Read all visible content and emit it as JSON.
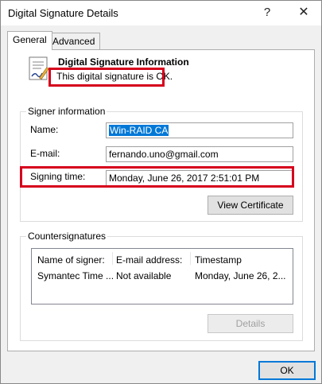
{
  "window": {
    "title": "Digital Signature Details",
    "help_label": "?",
    "close_label": "✕"
  },
  "tabs": [
    {
      "label": "General"
    },
    {
      "label": "Advanced"
    }
  ],
  "info": {
    "title": "Digital Signature Information",
    "status": "This digital signature is OK."
  },
  "signer": {
    "group_label": "Signer information",
    "name_label": "Name:",
    "name_value": "Win-RAID CA",
    "email_label": "E-mail:",
    "email_value": "fernando.uno@gmail.com",
    "time_label": "Signing time:",
    "time_value": "Monday, June 26, 2017 2:51:01 PM",
    "view_certificate_label": "View Certificate"
  },
  "countersignatures": {
    "group_label": "Countersignatures",
    "columns": [
      "Name of signer:",
      "E-mail address:",
      "Timestamp"
    ],
    "rows": [
      [
        "Symantec Time ...",
        "Not available",
        "Monday, June 26, 2..."
      ]
    ],
    "details_label": "Details"
  },
  "footer": {
    "ok_label": "OK"
  },
  "colors": {
    "highlight_box": "#d6001c",
    "selection": "#0078d7"
  },
  "icons": [
    "certificate-icon",
    "help-icon",
    "close-icon"
  ]
}
